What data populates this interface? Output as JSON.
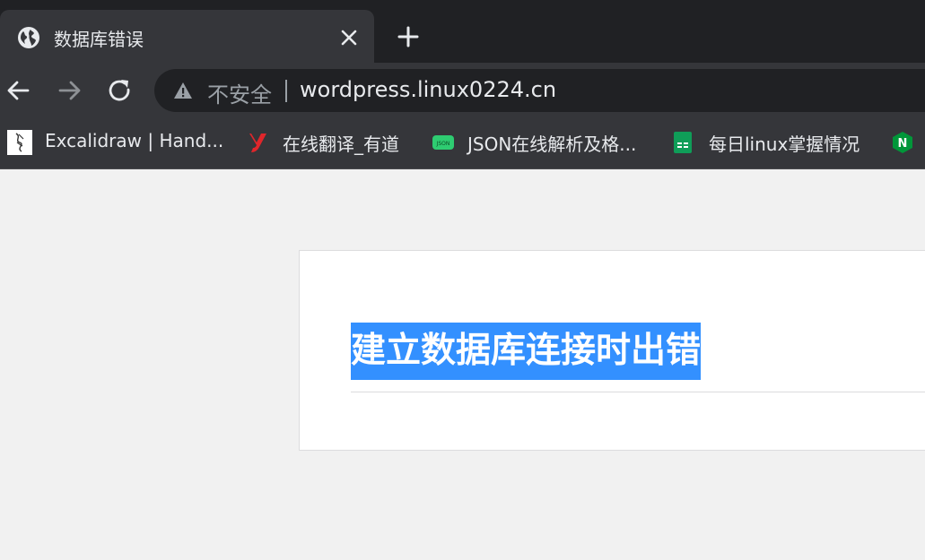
{
  "browser": {
    "tab": {
      "title": "数据库错误",
      "favicon": "globe-icon",
      "close_icon": "close-icon"
    },
    "new_tab_icon": "plus-icon",
    "toolbar": {
      "back_icon": "arrow-left-icon",
      "forward_icon": "arrow-right-icon",
      "reload_icon": "reload-icon",
      "security_icon": "warning-triangle-icon",
      "security_label": "不安全",
      "url": "wordpress.linux0224.cn"
    },
    "bookmarks": [
      {
        "label": "Excalidraw | Hand...",
        "icon": "excalidraw-icon"
      },
      {
        "label": "在线翻译_有道",
        "icon": "youdao-icon"
      },
      {
        "label": "JSON在线解析及格...",
        "icon": "json-icon",
        "icon_text": "JSON"
      },
      {
        "label": "每日linux掌握情况",
        "icon": "sheets-icon"
      },
      {
        "label": "",
        "icon": "nginx-icon",
        "icon_text": "N"
      }
    ]
  },
  "page": {
    "error_title": "建立数据库连接时出错"
  },
  "colors": {
    "chrome_dark": "#202124",
    "chrome_toolbar": "#35363a",
    "page_bg": "#f1f1f1",
    "selection": "#3390ff",
    "youdao_red": "#e0262b",
    "json_green": "#2ecc71",
    "sheets_green": "#0f9d58",
    "nginx_green": "#009639"
  }
}
